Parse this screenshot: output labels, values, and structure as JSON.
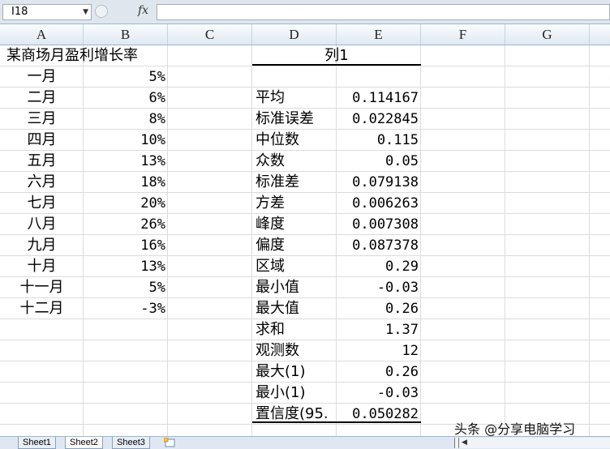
{
  "name_box": "I18",
  "formula_icon": "fx-icon",
  "columns": [
    "A",
    "B",
    "C",
    "D",
    "E",
    "F",
    "G"
  ],
  "column_a": {
    "title": "某商场月盈利增长率",
    "months": [
      "一月",
      "二月",
      "三月",
      "四月",
      "五月",
      "六月",
      "七月",
      "八月",
      "九月",
      "十月",
      "十一月",
      "十二月"
    ]
  },
  "column_b": [
    "5%",
    "6%",
    "8%",
    "10%",
    "13%",
    "18%",
    "20%",
    "26%",
    "16%",
    "13%",
    "5%",
    "-3%"
  ],
  "stats": {
    "header": "列1",
    "labels": [
      "平均",
      "标准误差",
      "中位数",
      "众数",
      "标准差",
      "方差",
      "峰度",
      "偏度",
      "区域",
      "最小值",
      "最大值",
      "求和",
      "观测数",
      "最大(1)",
      "最小(1)",
      "置信度(95."
    ],
    "values": [
      "0.114167",
      "0.022845",
      "0.115",
      "0.05",
      "0.079138",
      "0.006263",
      "0.007308",
      "0.087378",
      "0.29",
      "-0.03",
      "0.26",
      "1.37",
      "12",
      "0.26",
      "-0.03",
      "0.050282"
    ]
  },
  "sheet_tabs": [
    "Sheet1",
    "Sheet2",
    "Sheet3"
  ],
  "active_tab": "Sheet2",
  "watermark": "头条 @分享电脑学习"
}
